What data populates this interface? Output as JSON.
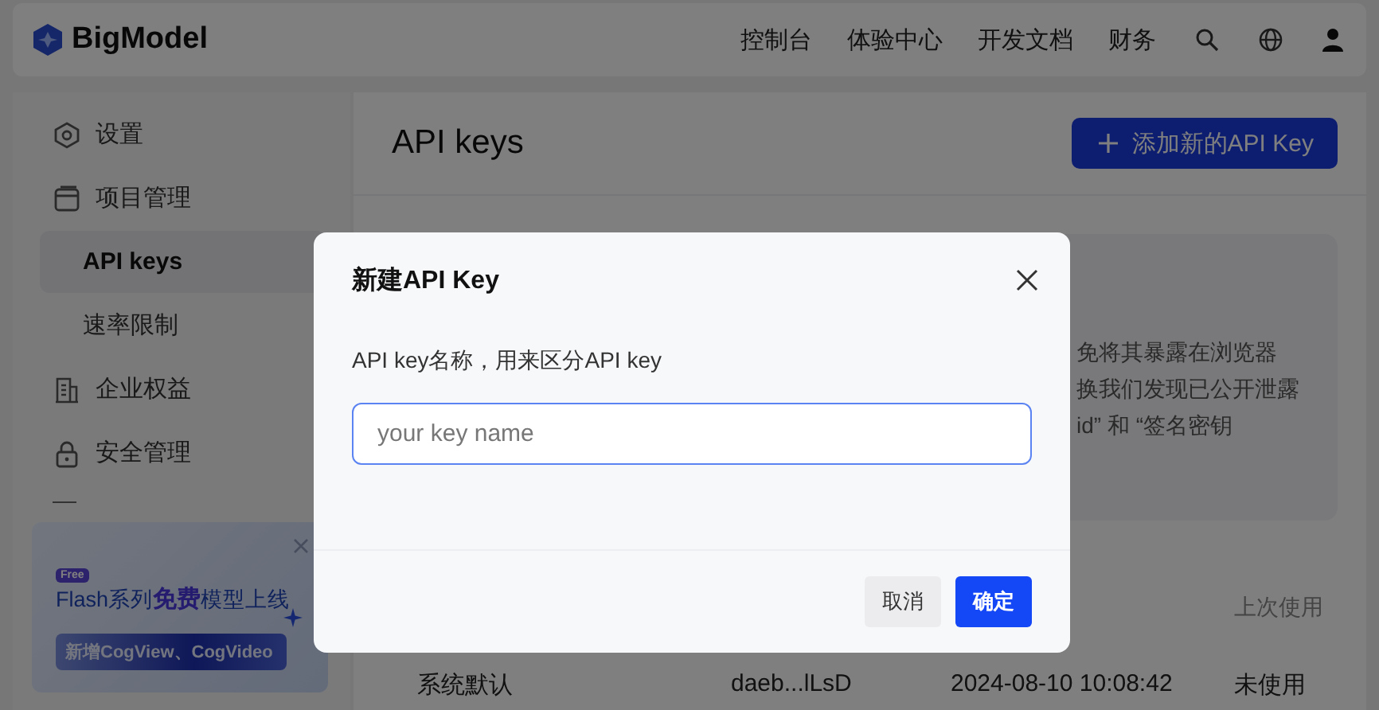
{
  "topbar": {
    "logo": "BigModel",
    "nav": [
      {
        "label": "控制台"
      },
      {
        "label": "体验中心"
      },
      {
        "label": "开发文档"
      },
      {
        "label": "财务"
      }
    ]
  },
  "sidebar": {
    "items": [
      {
        "label": "设置",
        "selected": false
      },
      {
        "label": "项目管理",
        "selected": false,
        "children": [
          {
            "label": "API keys",
            "selected": true
          },
          {
            "label": "速率限制",
            "selected": false
          }
        ]
      },
      {
        "label": "企业权益",
        "selected": false
      },
      {
        "label": "安全管理",
        "selected": false
      }
    ]
  },
  "promo": {
    "badge": "Free",
    "headline": "Flash系列**免费**模型上线",
    "subline": "新增CogView、CogVideo"
  },
  "page": {
    "title": "API keys",
    "add_button": "添加新的API Key",
    "notice_lines": [
      "免将其暴露在浏览器",
      "换我们发现已公开泄露",
      "id” 和 “签名密钥"
    ],
    "table": {
      "header": "上次使用",
      "rows": [
        {
          "cells": [
            "系统默认",
            "daeb...lLsD",
            "2024-08-10 10:08:42",
            "未使用"
          ]
        }
      ]
    }
  },
  "modal": {
    "title": "新建API Key",
    "field_label": "API key名称，用来区分API key",
    "input": {
      "placeholder": "your key name",
      "focused": true
    },
    "buttons": [
      {
        "label": "取消",
        "kind": "secondary"
      },
      {
        "label": "确定",
        "kind": "primary"
      }
    ]
  }
}
